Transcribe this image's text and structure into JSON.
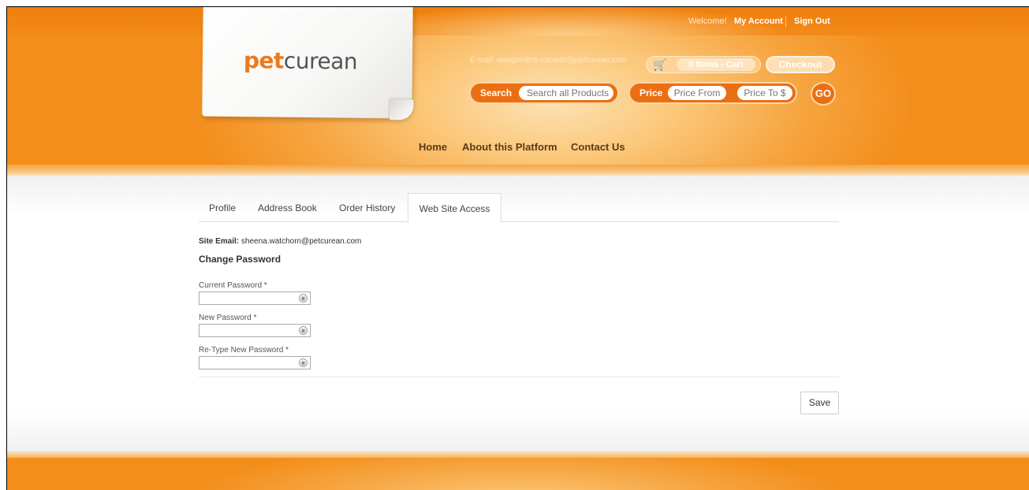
{
  "header": {
    "welcome": "Welcome!",
    "my_account": "My Account",
    "sign_out": "Sign Out",
    "logo_pet": "pet",
    "logo_curean": "curean",
    "email_line": "E-mail: awagorders-canada@petcurean.com",
    "cart_label": "0 Items - Cart",
    "checkout_label": "Checkout",
    "search_label": "Search",
    "search_placeholder": "Search all Products",
    "price_label": "Price",
    "price_from_placeholder": "Price From",
    "price_to_placeholder": "Price To $",
    "go_label": "GO",
    "nav": {
      "home": "Home",
      "about": "About this Platform",
      "contact": "Contact Us"
    }
  },
  "tabs": {
    "profile": "Profile",
    "address_book": "Address Book",
    "order_history": "Order History",
    "web_site_access": "Web Site Access",
    "active": "Web Site Access"
  },
  "account": {
    "site_email_label": "Site Email:",
    "site_email_value": "sheena.watchorn@petcurean.com",
    "change_password_heading": "Change Password",
    "current_password_label": "Current Password *",
    "new_password_label": "New Password *",
    "retype_password_label": "Re-Type New Password *",
    "current_password_value": "",
    "new_password_value": "",
    "retype_password_value": "",
    "save_label": "Save"
  },
  "colors": {
    "brand_orange": "#eb6f12",
    "header_orange": "#f38e1b",
    "nav_text": "#5a3a15"
  },
  "icons": {
    "cart": "cart-icon",
    "password_reveal": "key-icon"
  }
}
